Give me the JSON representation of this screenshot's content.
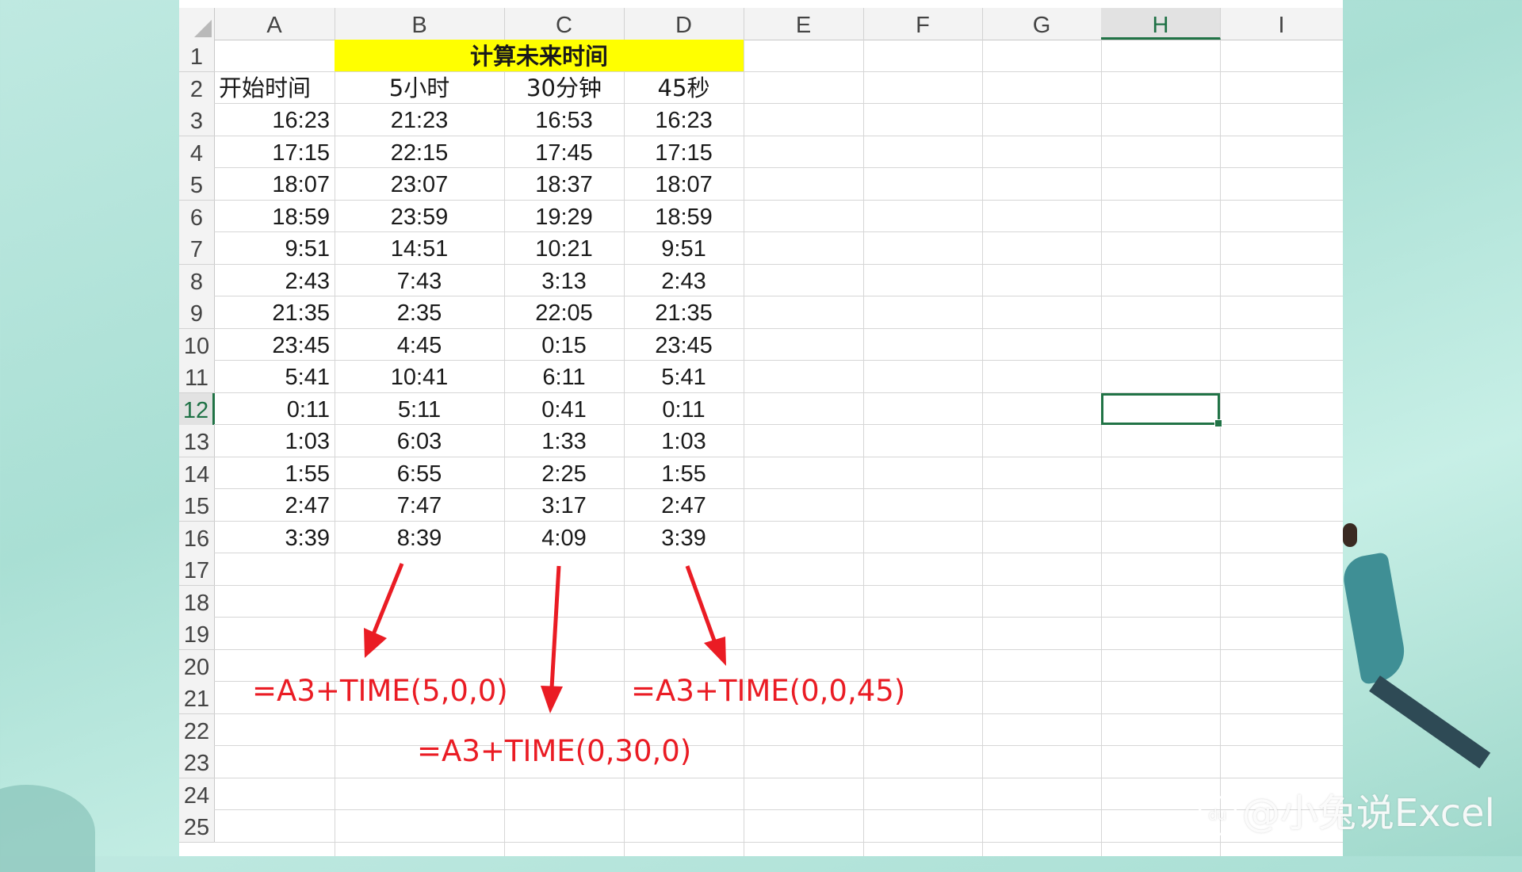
{
  "columns": [
    "A",
    "B",
    "C",
    "D",
    "E",
    "F",
    "G",
    "H",
    "I"
  ],
  "active_column": "H",
  "rows": [
    "1",
    "2",
    "3",
    "4",
    "5",
    "6",
    "7",
    "8",
    "9",
    "10",
    "11",
    "12",
    "13",
    "14",
    "15",
    "16",
    "17",
    "18",
    "19",
    "20",
    "21",
    "22",
    "23",
    "24",
    "25"
  ],
  "active_row": "12",
  "title": "计算未来时间",
  "headers": [
    "开始时间",
    "5小时",
    "30分钟",
    "45秒"
  ],
  "data": [
    [
      "16:23",
      "21:23",
      "16:53",
      "16:23"
    ],
    [
      "17:15",
      "22:15",
      "17:45",
      "17:15"
    ],
    [
      "18:07",
      "23:07",
      "18:37",
      "18:07"
    ],
    [
      "18:59",
      "23:59",
      "19:29",
      "18:59"
    ],
    [
      "9:51",
      "14:51",
      "10:21",
      "9:51"
    ],
    [
      "2:43",
      "7:43",
      "3:13",
      "2:43"
    ],
    [
      "21:35",
      "2:35",
      "22:05",
      "21:35"
    ],
    [
      "23:45",
      "4:45",
      "0:15",
      "23:45"
    ],
    [
      "5:41",
      "10:41",
      "6:11",
      "5:41"
    ],
    [
      "0:11",
      "5:11",
      "0:41",
      "0:11"
    ],
    [
      "1:03",
      "6:03",
      "1:33",
      "1:03"
    ],
    [
      "1:55",
      "6:55",
      "2:25",
      "1:55"
    ],
    [
      "2:47",
      "7:47",
      "3:17",
      "2:47"
    ],
    [
      "3:39",
      "8:39",
      "4:09",
      "3:39"
    ]
  ],
  "formulas": {
    "hours": "=A3+TIME(5,0,0)",
    "minutes": "=A3+TIME(0,30,0)",
    "seconds": "=A3+TIME(0,0,45)"
  },
  "watermark": "@小兔说Excel",
  "watermark_icon": "du",
  "colors": {
    "accent": "#217346",
    "highlight": "#ffff00",
    "annotation": "#ea1c24"
  }
}
